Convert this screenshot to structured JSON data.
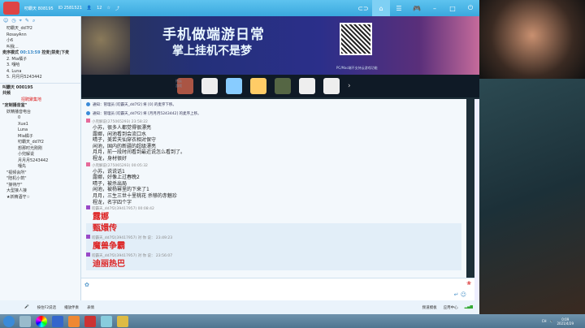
{
  "header": {
    "title": "叨霸天 808195",
    "id": "ID 2581521",
    "fans": "12"
  },
  "top_nav": [
    "home",
    "list",
    "gamepad"
  ],
  "left": {
    "users": [
      "叨霸天_dd7f2",
      "RosayAnn",
      "小6",
      "叫我..."
    ],
    "queue": {
      "mode": "麦序模式",
      "timer": "00:13:59",
      "controls": [
        "控麦",
        "禁麦",
        "下麦"
      ]
    },
    "queue_list": [
      {
        "n": "2.",
        "name": "Mia橘子"
      },
      {
        "n": "3.",
        "name": "嘎哈"
      },
      {
        "n": "4.",
        "name": "Luna"
      },
      {
        "n": "5.",
        "name": "月月月5243442"
      }
    ],
    "channel": "叫霸天 000195",
    "channel_sub": "共频",
    "announce": "招聘聚集地",
    "group": "\"定制播音室\"",
    "subgroup": "妖精播音电台",
    "members": [
      "0",
      "Xue1",
      "Luna",
      "Mia橘子",
      "叨霸天_dd7f2",
      "想那时光刚刚",
      "小兜解说",
      "月月月5243442",
      "嘎先"
    ],
    "more": [
      "\"视频会所\"",
      "\"陪机小筑\"",
      "\"接待厅\"",
      "大型接人接",
      "★妖精酒守☆"
    ]
  },
  "banner": {
    "line1": "手机做端游日常",
    "line2": "掌上挂机不是梦",
    "qr_caption": "PC/Mac端不支持云游戏功能",
    "strip_label": "热云游戏"
  },
  "chat": {
    "notices": [
      "通知：管理员 [叨霸天_dd7f2] 将 [0] 的麦序下移。",
      "通知：管理员 [叨霸天_dd7f2] 将 [月月月5243442] 的麦序上移。"
    ],
    "messages": [
      {
        "meta": "小兜解说(275065293) 23:58:22",
        "lines": [
          "小苏，很多人都觉得很漂亮",
          "露娜，闲池看到会流口水",
          "晴子，美若天仙穿衣相对保守",
          "闲池，国内的新疆的超级漂亮",
          "月月，前一段时间看到最近说怎么看到了。",
          "程龙，身材很好"
        ]
      },
      {
        "meta": "小兜解说(275065293) 00:05:32",
        "lines": [
          "小苏，说说话1",
          "露娜，好像上过春晚2",
          "晴子，被杀出局",
          "闲池，被杨幂里的下来了1",
          "月月，三生三世十里桃花 杀够的赤魅珍",
          "程龙，名字四个字"
        ]
      }
    ],
    "big": [
      {
        "meta": "叨霸天_dd7f2(39417957) 00:08:42",
        "texts": [
          "露娜",
          "甄嬛传"
        ]
      },
      {
        "meta": "叨霸天_dd7f2(39417957) 对 你 说： 23:49:23",
        "texts": [
          "魔兽争霸"
        ]
      },
      {
        "meta": "叨霸天_dd7f2(39417957) 对 你 说： 23:56:07",
        "texts": [
          "迪丽热巴"
        ]
      }
    ]
  },
  "bottom": {
    "items": [
      "按住F2说话",
      "播放伴奏",
      "表情"
    ],
    "right": [
      "频道模板",
      "应用中心"
    ]
  },
  "tray": {
    "lang": "CH",
    "time": "0:09",
    "date": "2021/4/29"
  }
}
